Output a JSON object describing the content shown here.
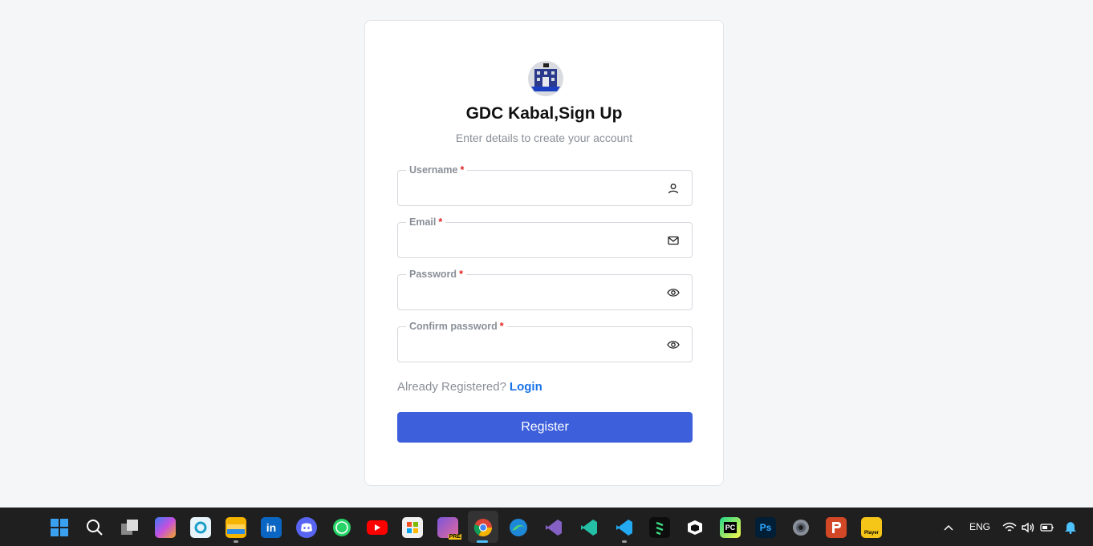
{
  "form": {
    "title": "GDC Kabal,Sign Up",
    "subtitle": "Enter details to create your account",
    "fields": [
      {
        "label": "Username",
        "required_mark": "*",
        "value": "",
        "icon": "user-icon"
      },
      {
        "label": "Email",
        "required_mark": "*",
        "value": "",
        "icon": "mail-icon"
      },
      {
        "label": "Password",
        "required_mark": "*",
        "value": "",
        "icon": "eye-icon"
      },
      {
        "label": "Confirm password",
        "required_mark": "*",
        "value": "",
        "icon": "eye-icon"
      }
    ],
    "login_prompt": "Already Registered?",
    "login_link": "Login",
    "register_label": "Register"
  },
  "colors": {
    "primary_button": "#3d5fdc",
    "link": "#1a73e8",
    "required": "#e02424",
    "taskbar": "#1f1f1f"
  },
  "taskbar": {
    "apps": [
      "windows-start-icon",
      "search-icon",
      "task-view-icon",
      "copilot-icon",
      "app-icon",
      "file-explorer-icon",
      "linkedin-icon",
      "discord-icon",
      "whatsapp-icon",
      "youtube-icon",
      "microsoft-store-icon",
      "home-pre-icon",
      "chrome-icon",
      "edge-icon",
      "visual-studio-icon",
      "vscode-insiders-icon",
      "vscode-icon",
      "terminal-app-icon",
      "box-app-icon",
      "pycharm-icon",
      "photoshop-icon",
      "settings-icon",
      "powerpoint-icon",
      "player-icon"
    ],
    "language": "ENG",
    "ps_label": "Ps",
    "pc_label": "PC",
    "player_label": "Player",
    "pre_label": "PRE"
  }
}
